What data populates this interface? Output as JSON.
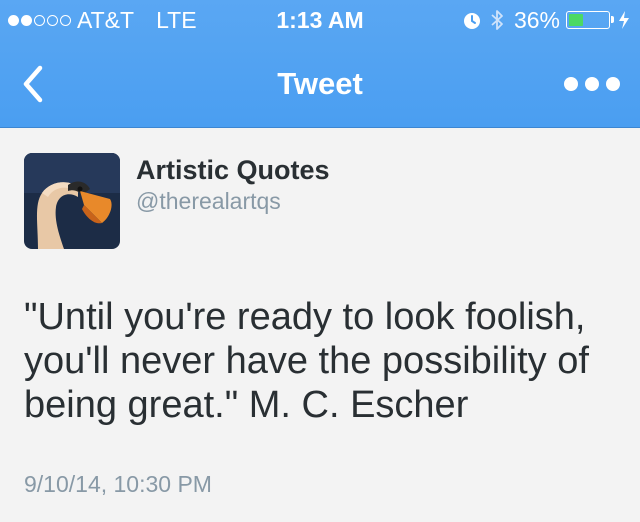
{
  "status_bar": {
    "carrier": "AT&T",
    "network": "LTE",
    "time": "1:13 AM",
    "battery_percent": "36%",
    "battery_level": 0.36,
    "signal_bars_filled": 2,
    "signal_bars_total": 5
  },
  "nav": {
    "title": "Tweet",
    "back_icon": "chevron-left-icon",
    "more_icon": "more-dots-icon"
  },
  "tweet": {
    "display_name": "Artistic Quotes",
    "username": "@therealartqs",
    "text_lines": [
      "\"Until you're ready to look foolish,",
      "you'll never have the possibility of",
      "being great.\" M. C. Escher"
    ],
    "timestamp": "9/10/14, 10:30 PM"
  },
  "colors": {
    "header_blue": "#4a9ef1",
    "background": "#f3f3f3",
    "text_primary": "#292f33",
    "text_secondary": "#8899a6",
    "battery_green": "#4cd964"
  }
}
